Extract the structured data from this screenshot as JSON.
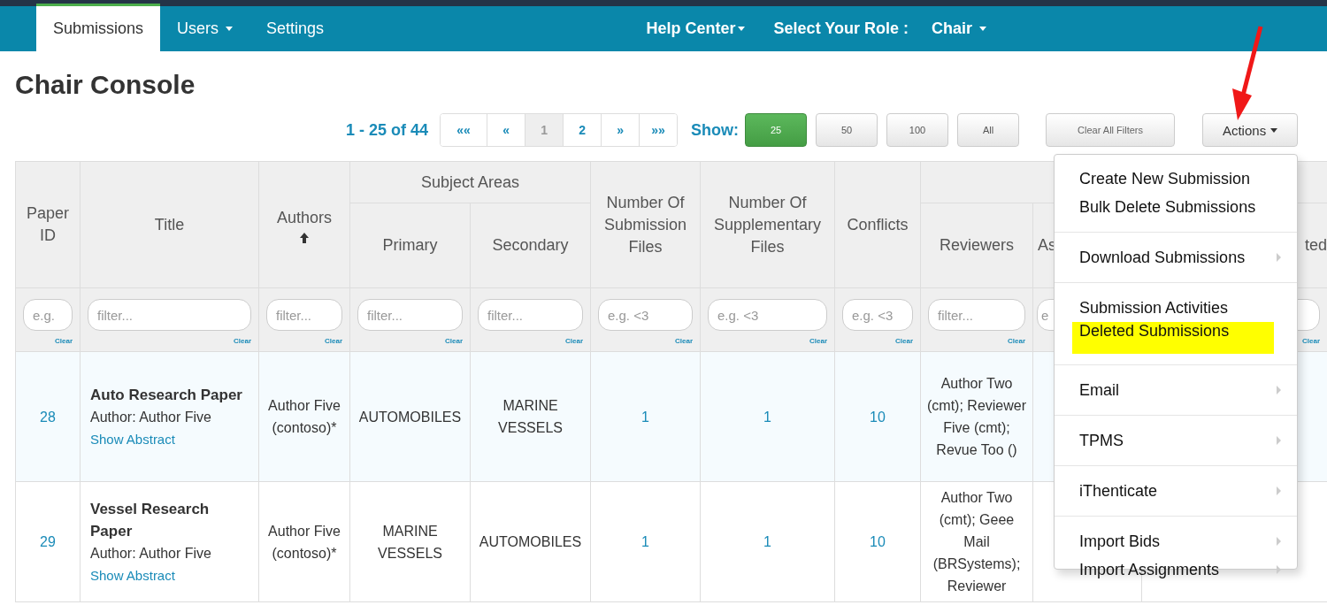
{
  "navbar": {
    "tabs": [
      {
        "label": "Submissions",
        "selected": true,
        "dropdown": false
      },
      {
        "label": "Users",
        "selected": false,
        "dropdown": true
      },
      {
        "label": "Settings",
        "selected": false,
        "dropdown": false
      }
    ],
    "help": {
      "label": "Help Center",
      "dropdown": true
    },
    "role_label": "Select Your Role :",
    "role": {
      "label": "Chair",
      "dropdown": true
    }
  },
  "page_title": "Chair Console",
  "toolbar": {
    "range": "1 - 25 of 44",
    "pages": [
      {
        "label": "««",
        "selected": false
      },
      {
        "label": "«",
        "selected": false
      },
      {
        "label": "1",
        "selected": true
      },
      {
        "label": "2",
        "selected": false
      },
      {
        "label": "»",
        "selected": false
      },
      {
        "label": "»»",
        "selected": false
      }
    ],
    "show_label": "Show:",
    "page_sizes": [
      {
        "label": "25",
        "selected": true
      },
      {
        "label": "50",
        "selected": false
      },
      {
        "label": "100",
        "selected": false
      },
      {
        "label": "All",
        "selected": false
      }
    ],
    "clear_filters": "Clear All Filters",
    "actions": "Actions"
  },
  "actions_menu": {
    "groups": [
      {
        "items": [
          {
            "label": "Create New Submission",
            "submenu": false,
            "highlighted": false
          },
          {
            "label": "Bulk Delete Submissions",
            "submenu": false,
            "highlighted": false
          }
        ]
      },
      {
        "items": [
          {
            "label": "Download Submissions",
            "submenu": true,
            "highlighted": false
          }
        ]
      },
      {
        "items": [
          {
            "label": "Submission Activities",
            "submenu": false,
            "highlighted": false
          },
          {
            "label": "Deleted Submissions",
            "submenu": false,
            "highlighted": true
          }
        ]
      },
      {
        "items": [
          {
            "label": "Email",
            "submenu": true,
            "highlighted": false
          }
        ]
      },
      {
        "items": [
          {
            "label": "TPMS",
            "submenu": true,
            "highlighted": false
          }
        ]
      },
      {
        "items": [
          {
            "label": "iThenticate",
            "submenu": true,
            "highlighted": false
          }
        ]
      },
      {
        "items": [
          {
            "label": "Import Bids",
            "submenu": true,
            "highlighted": false
          },
          {
            "label": "Import Assignments",
            "submenu": true,
            "highlighted": false
          }
        ]
      }
    ]
  },
  "table": {
    "column_groups": [
      {
        "label": "Subject Areas"
      }
    ],
    "columns": [
      {
        "label": "Paper ID",
        "sorted": false,
        "in_group": false,
        "filter": {
          "placeholder": "e.g.",
          "clear": "Clear"
        }
      },
      {
        "label": "Title",
        "sorted": false,
        "in_group": false,
        "filter": {
          "placeholder": "filter...",
          "clear": "Clear"
        }
      },
      {
        "label": "Authors",
        "sorted": true,
        "in_group": false,
        "filter": {
          "placeholder": "filter...",
          "clear": "Clear"
        }
      },
      {
        "label": "Primary",
        "sorted": false,
        "in_group": true,
        "filter": {
          "placeholder": "filter...",
          "clear": "Clear"
        }
      },
      {
        "label": "Secondary",
        "sorted": false,
        "in_group": true,
        "filter": {
          "placeholder": "filter...",
          "clear": "Clear"
        }
      },
      {
        "label": "Number Of Submission Files",
        "sorted": false,
        "in_group": false,
        "filter": {
          "placeholder": "e.g. <3",
          "clear": "Clear"
        }
      },
      {
        "label": "Number Of Supplementary Files",
        "sorted": false,
        "in_group": false,
        "filter": {
          "placeholder": "e.g. <3",
          "clear": "Clear"
        }
      },
      {
        "label": "Conflicts",
        "sorted": false,
        "in_group": false,
        "filter": {
          "placeholder": "e.g. <3",
          "clear": "Clear"
        }
      },
      {
        "label": "Reviewers",
        "sorted": false,
        "in_group": true,
        "filter": {
          "placeholder": "filter...",
          "clear": "Clear"
        }
      },
      {
        "label": "As",
        "sorted": false,
        "in_group": true,
        "filter": {
          "placeholder": "e"
        }
      },
      {
        "label": "ted",
        "sorted": false,
        "in_group": true,
        "filter": {
          "clear": "Clear"
        }
      }
    ],
    "rows": [
      {
        "highlighted": true,
        "cells": [
          {
            "kind": "link",
            "text": "28"
          },
          {
            "kind": "title",
            "title": "Auto Research Paper",
            "author": "Author: Author Five",
            "link": "Show Abstract"
          },
          {
            "kind": "text",
            "text": "Author Five (contoso)*"
          },
          {
            "kind": "text",
            "text": "AUTOMOBILES"
          },
          {
            "kind": "text",
            "text": "MARINE VESSELS"
          },
          {
            "kind": "link",
            "text": "1"
          },
          {
            "kind": "link",
            "text": "1"
          },
          {
            "kind": "link",
            "text": "10"
          },
          {
            "kind": "text",
            "text": "Author Two (cmt); Reviewer Five (cmt); Revue Too ()"
          }
        ]
      },
      {
        "highlighted": false,
        "cells": [
          {
            "kind": "link",
            "text": "29"
          },
          {
            "kind": "title",
            "title": "Vessel Research Paper",
            "author": "Author: Author Five",
            "link": "Show Abstract"
          },
          {
            "kind": "text",
            "text": "Author Five (contoso)*"
          },
          {
            "kind": "text",
            "text": "MARINE VESSELS"
          },
          {
            "kind": "text",
            "text": "AUTOMOBILES"
          },
          {
            "kind": "link",
            "text": "1"
          },
          {
            "kind": "link",
            "text": "1"
          },
          {
            "kind": "link",
            "text": "10"
          },
          {
            "kind": "text",
            "text": "Author Two (cmt); Geee Mail (BRSystems); Reviewer"
          }
        ]
      }
    ]
  }
}
